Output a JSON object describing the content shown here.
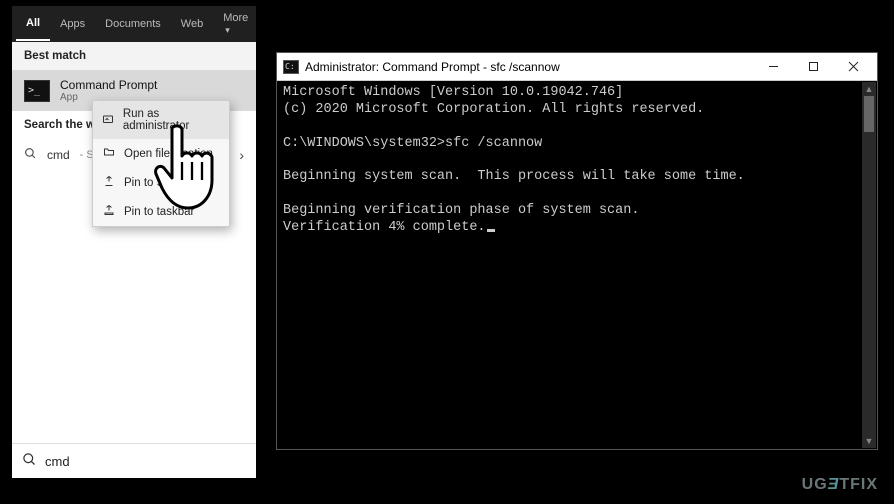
{
  "search": {
    "tabs": [
      "All",
      "Apps",
      "Documents",
      "Web",
      "More"
    ],
    "active_tab": 0,
    "best_match_header": "Best match",
    "best_match": {
      "title": "Command Prompt",
      "subtitle": "App"
    },
    "search_web_header": "Search the web",
    "web_result": {
      "query": "cmd",
      "suffix": "- See"
    },
    "context_menu": [
      {
        "label": "Run as administrator",
        "icon": "admin-icon"
      },
      {
        "label": "Open file location",
        "icon": "folder-icon"
      },
      {
        "label": "Pin to Start",
        "icon": "pin-start-icon"
      },
      {
        "label": "Pin to taskbar",
        "icon": "pin-taskbar-icon"
      }
    ],
    "input_value": "cmd"
  },
  "cmd": {
    "title": "Administrator: Command Prompt - sfc  /scannow",
    "lines": [
      "Microsoft Windows [Version 10.0.19042.746]",
      "(c) 2020 Microsoft Corporation. All rights reserved.",
      "",
      "C:\\WINDOWS\\system32>sfc /scannow",
      "",
      "Beginning system scan.  This process will take some time.",
      "",
      "Beginning verification phase of system scan.",
      "Verification 4% complete."
    ]
  },
  "watermark": {
    "pre": "UG",
    "e": "Ǝ",
    "post": "TFIX"
  }
}
